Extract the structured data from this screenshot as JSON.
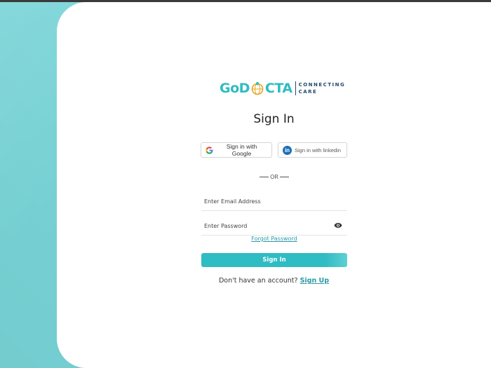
{
  "brand": {
    "logo_left": "GoD",
    "logo_right": "CTA",
    "tagline_line1": "CONNECTING",
    "tagline_line2": "CARE",
    "primary_color": "#2fbcc3",
    "navy_color": "#244a6e",
    "background_color": "#78d4d7"
  },
  "signin": {
    "title": "Sign In",
    "google_label": "Sign in with Google",
    "linkedin_label": "Sign in with linkedin",
    "or_text": "OR",
    "email_placeholder": "Enter Email Address",
    "password_placeholder": "Enter Password",
    "forgot_label": "Forgot Password",
    "submit_label": "Sign In",
    "no_account_text": "Don't have an account?",
    "signup_label": "Sign Up"
  },
  "icons": {
    "google": "google-icon",
    "linkedin": "linkedin-icon",
    "eye": "eye-icon",
    "globe": "globe-icon"
  }
}
